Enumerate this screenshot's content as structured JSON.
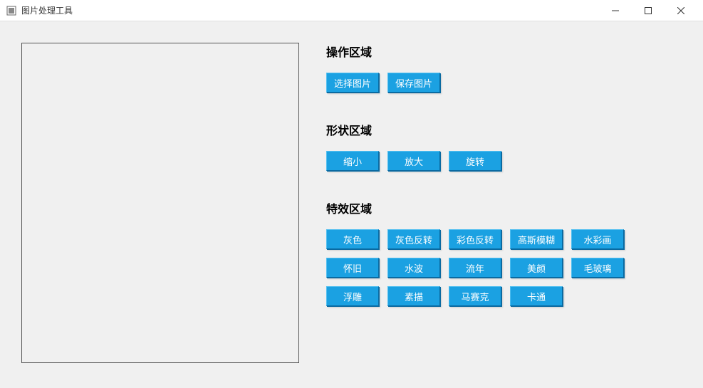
{
  "window": {
    "title": "图片处理工具"
  },
  "sections": {
    "operation": {
      "heading": "操作区域",
      "buttons": {
        "select": "选择图片",
        "save": "保存图片"
      }
    },
    "shape": {
      "heading": "形状区域",
      "buttons": {
        "shrink": "缩小",
        "enlarge": "放大",
        "rotate": "旋转"
      }
    },
    "effects": {
      "heading": "特效区域",
      "buttons": {
        "gray": "灰色",
        "gray_invert": "灰色反转",
        "color_invert": "彩色反转",
        "gaussian_blur": "高斯模糊",
        "watercolor": "水彩画",
        "vintage": "怀旧",
        "water_wave": "水波",
        "years": "流年",
        "beauty": "美颜",
        "frosted_glass": "毛玻璃",
        "emboss": "浮雕",
        "sketch": "素描",
        "mosaic": "马赛克",
        "cartoon": "卡通"
      }
    }
  }
}
